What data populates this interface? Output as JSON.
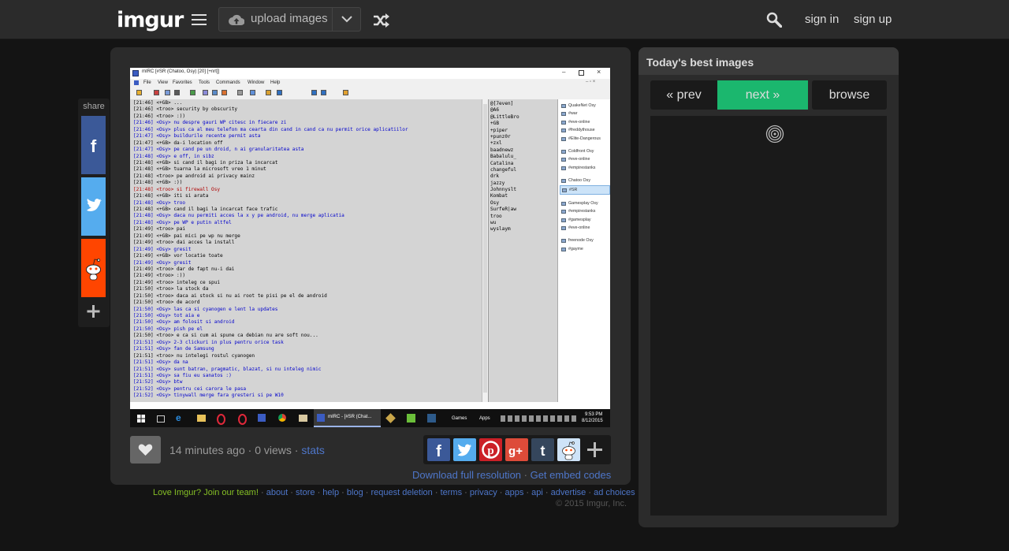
{
  "header": {
    "logo": "imgur",
    "upload_label": "upload images",
    "sign_in": "sign in",
    "sign_up": "sign up"
  },
  "share_rail": {
    "label": "share"
  },
  "post": {
    "timestamp": "14 minutes ago",
    "views": "0 views",
    "stats_link": "stats",
    "download_link": "Download full resolution",
    "embed_link": "Get embed codes"
  },
  "footer": {
    "love": "Love Imgur? Join our team!",
    "links": [
      "about",
      "store",
      "help",
      "blog",
      "request deletion",
      "terms",
      "privacy",
      "apps",
      "api",
      "advertise",
      "ad choices"
    ],
    "copyright": "© 2015 Imgur, Inc."
  },
  "sidebar": {
    "title": "Today's best images",
    "prev": "« prev",
    "next": "next »",
    "browse": "browse"
  },
  "mirc": {
    "window_title": "mIRC [#SR (Chatoo, Osy) [20] [+nrt]]",
    "menu": [
      "File",
      "View",
      "Favorites",
      "Tools",
      "Commands",
      "Window",
      "Help"
    ],
    "chat_lines": [
      {
        "t": "[21:46] <+GB> ...",
        "c": "k"
      },
      {
        "t": "[21:46] <troo> security by obscurity",
        "c": "k"
      },
      {
        "t": "[21:46] <troo> :))",
        "c": "k"
      },
      {
        "t": "[21:46] <Osy> nu despre gauri WP citesc in fiecare zi",
        "c": "b"
      },
      {
        "t": "[21:46] <Osy> plus ca al meu telefon ma cearta din cand in cand ca nu permit orice aplicatiilor",
        "c": "b"
      },
      {
        "t": "[21:47] <Osy> buildurile recente permit asta",
        "c": "b"
      },
      {
        "t": "[21:47] <+GB> da-i location off",
        "c": "k"
      },
      {
        "t": "[21:47] <Osy> pe cand pe un droid, n ai granularitatea asta",
        "c": "b"
      },
      {
        "t": "[21:48] <Osy> e off, in sibz",
        "c": "b"
      },
      {
        "t": "[21:48] <+GB> si cand il bagi in priza la incarcat",
        "c": "k"
      },
      {
        "t": "[21:48] <+GB> tuarna la microsoft vreo 1 minut",
        "c": "k"
      },
      {
        "t": "[21:48] <troo> pe android ai privacy mainz",
        "c": "k"
      },
      {
        "t": "[21:48] <+GB> :))",
        "c": "k"
      },
      {
        "t": "[21:48] <troo> si firewall Osy",
        "c": "r"
      },
      {
        "t": "[21:48] <+GB> iti si arata",
        "c": "k"
      },
      {
        "t": "[21:48] <Osy> troo",
        "c": "b"
      },
      {
        "t": "[21:48] <+GB> cand il bagi la incarcat face trafic",
        "c": "k"
      },
      {
        "t": "[21:48] <Osy> daca nu permiti acces la x y pe android, nu merge aplicatia",
        "c": "b"
      },
      {
        "t": "[21:48] <Osy> pe WP e putin altfel",
        "c": "b"
      },
      {
        "t": "[21:49] <troo> pai",
        "c": "k"
      },
      {
        "t": "[21:49] <+GB> pai mici pe wp nu merge",
        "c": "k"
      },
      {
        "t": "[21:49] <troo> dai acces la install",
        "c": "k"
      },
      {
        "t": "[21:49] <Osy> gresit",
        "c": "b"
      },
      {
        "t": "[21:49] <+GB> vor locatie toate",
        "c": "k"
      },
      {
        "t": "[21:49] <Osy> gresit",
        "c": "b"
      },
      {
        "t": "[21:49] <troo> dar de fapt nu-i dai",
        "c": "k"
      },
      {
        "t": "[21:49] <troo> :))",
        "c": "k"
      },
      {
        "t": "[21:49] <troo> inteleg ce spui",
        "c": "k"
      },
      {
        "t": "[21:50] <troo> la stock da",
        "c": "k"
      },
      {
        "t": "[21:50] <troo> daca ai stock si nu ai root te pisi pe el de android",
        "c": "k"
      },
      {
        "t": "[21:50] <troo> de acord",
        "c": "k"
      },
      {
        "t": "[21:50] <Osy> las ca si cyanogen e lent la updates",
        "c": "b"
      },
      {
        "t": "[21:50] <Osy> tot aia e",
        "c": "b"
      },
      {
        "t": "[21:50] <Osy> am folosit si android",
        "c": "b"
      },
      {
        "t": "[21:50] <Osy> pish pe el",
        "c": "b"
      },
      {
        "t": "[21:50] <troo> e ca si cum ai spune ca debian nu are soft nou...",
        "c": "k"
      },
      {
        "t": "[21:51] <Osy> 2-3 clickuri in plus pentru orice task",
        "c": "b"
      },
      {
        "t": "[21:51] <Osy> fan de Samsung",
        "c": "b"
      },
      {
        "t": "[21:51] <troo> nu intelegi rostul cyanogen",
        "c": "k"
      },
      {
        "t": "[21:51] <Osy> da na",
        "c": "b"
      },
      {
        "t": "[21:51] <Osy> sunt batran, pragmatic, blazat, si nu inteleg nimic",
        "c": "b"
      },
      {
        "t": "[21:51] <Osy> sa fiu eu sanatos :)",
        "c": "b"
      },
      {
        "t": "[21:52] <Osy> btw",
        "c": "b"
      },
      {
        "t": "[21:52] <Osy> pentru cei carora le pasa",
        "c": "b"
      },
      {
        "t": "[21:52] <Osy> tinywall merge fara gresteri si pe W10",
        "c": "b"
      }
    ],
    "nicks": [
      "@[7even]",
      "@A6",
      "@LittleBro",
      "+GB",
      "+piper",
      "+punz0r",
      "+zxl",
      "baadnewz",
      "Babalulu_",
      "Catalina",
      "changeful",
      "drk",
      "jazzy",
      "Johnnyslt",
      "Kombat",
      "Osy",
      "SurfeR|aw",
      "troo",
      "wu",
      "wyslaym"
    ],
    "tree_groups": [
      [
        "QuakeNet Osy",
        "#war",
        "#eve-online",
        "#freddythouse",
        "#Elite-Dangerous"
      ],
      [
        "Coldfront Osy",
        "#eve-online",
        "#empirestanks"
      ],
      [
        "Chatoo Osy",
        "#SR"
      ],
      [
        "Gamesplay Osy",
        "#empirestanks",
        "#gamesplay",
        "#eve-online"
      ],
      [
        "freenode Osy",
        "#gayme"
      ]
    ],
    "taskbar_task": "mIRC - [#SR (Chat...",
    "taskbar_games": "Games",
    "taskbar_apps": "Apps",
    "clock_time": "9:53 PM",
    "clock_date": "8/12/2015"
  }
}
